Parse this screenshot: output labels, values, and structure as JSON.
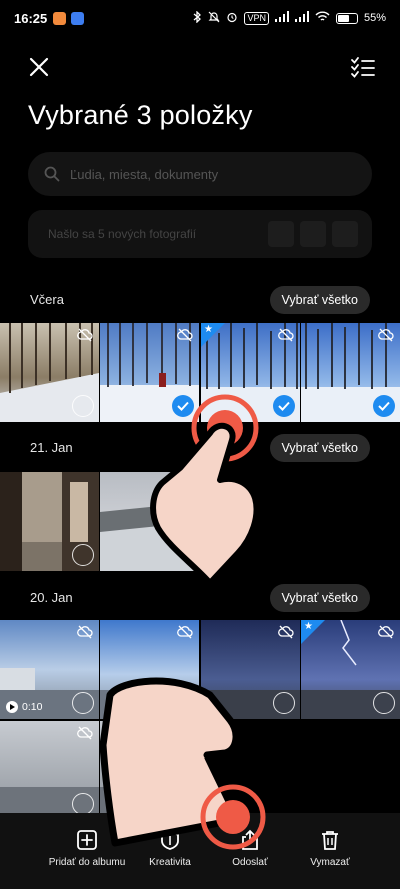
{
  "status_bar": {
    "time": "16:25",
    "vpn": "VPN",
    "battery": "55",
    "battery_unit": "%",
    "battery_level": 0.55
  },
  "header": {
    "close_icon": "close-icon",
    "select_icon": "checklist-icon",
    "title": "Vybrané 3 položky"
  },
  "search": {
    "placeholder": "Ľudia, miesta, dokumenty"
  },
  "new_photos": {
    "text": "Našlo sa 5 nových fotografií"
  },
  "sections": [
    {
      "date": "Včera",
      "select_all": "Vybrať všetko"
    },
    {
      "date": "21. Jan",
      "select_all": "Vybrať všetko"
    },
    {
      "date": "20. Jan",
      "select_all": "Vybrať všetko"
    }
  ],
  "video_duration": "0:10",
  "toolbar": {
    "add_album": "Pridať do albumu",
    "creativity": "Kreativita",
    "send": "Odoslať",
    "delete": "Vymazať"
  },
  "colors": {
    "accent": "#1e8bf0",
    "touch": "#ef5a46",
    "hand_fill": "#f6d5c8"
  }
}
